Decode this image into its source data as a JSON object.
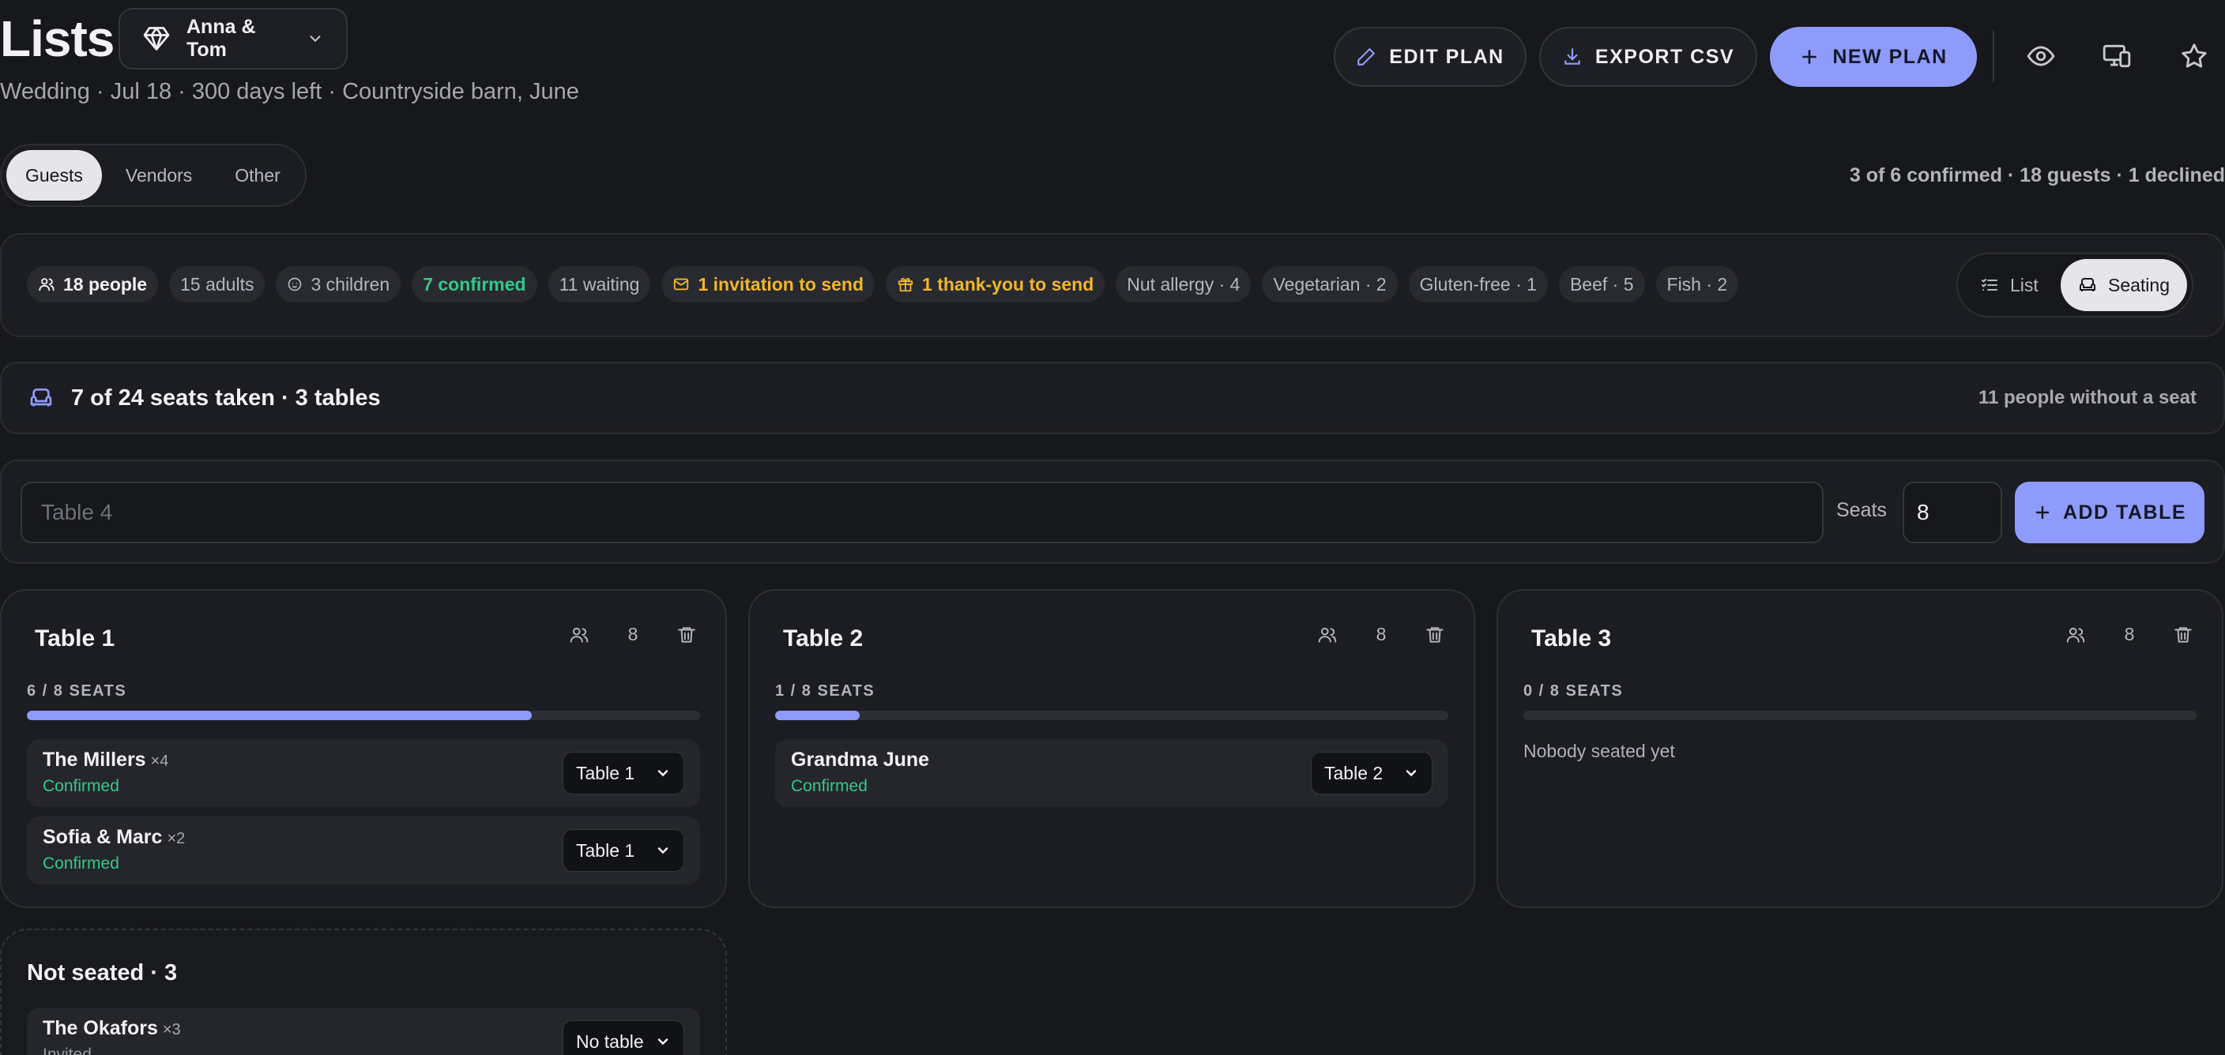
{
  "header": {
    "title": "Lists",
    "plan_name": "Anna & Tom",
    "subtitle": "Wedding · Jul 18 · 300 days left · Countryside barn, June",
    "edit_label": "EDIT PLAN",
    "export_label": "EXPORT CSV",
    "new_label": "NEW PLAN"
  },
  "tabs": {
    "items": [
      "Guests",
      "Vendors",
      "Other"
    ],
    "active": "Guests"
  },
  "summary": "3 of 6 confirmed · 18 guests · 1 declined",
  "chips": {
    "people": "18 people",
    "adults": "15 adults",
    "children": "3 children",
    "confirmed": "7 confirmed",
    "waiting": "11 waiting",
    "invitation": "1 invitation to send",
    "thankyou": "1 thank-you to send",
    "nut": "Nut allergy · 4",
    "veg": "Vegetarian · 2",
    "gluten": "Gluten-free · 1",
    "beef": "Beef · 5",
    "fish": "Fish · 2"
  },
  "view_toggle": {
    "list": "List",
    "seating": "Seating",
    "active": "Seating"
  },
  "seats_bar": {
    "text": "7 of 24 seats taken · 3 tables",
    "right": "11 people without a seat"
  },
  "add_table": {
    "placeholder": "Table 4",
    "seats_label": "Seats",
    "seats_value": "8",
    "button": "ADD TABLE"
  },
  "tables": [
    {
      "name": "Table 1",
      "capacity": "8",
      "seat_label": "6 / 8 SEATS",
      "fill": 0.75,
      "guests": [
        {
          "name": "The Millers",
          "count": "×4",
          "status": "Confirmed",
          "table": "Table 1"
        },
        {
          "name": "Sofia & Marc",
          "count": "×2",
          "status": "Confirmed",
          "table": "Table 1"
        }
      ]
    },
    {
      "name": "Table 2",
      "capacity": "8",
      "seat_label": "1 / 8 SEATS",
      "fill": 0.125,
      "guests": [
        {
          "name": "Grandma June",
          "count": "",
          "status": "Confirmed",
          "table": "Table 2"
        }
      ]
    },
    {
      "name": "Table 3",
      "capacity": "8",
      "seat_label": "0 / 8 SEATS",
      "fill": 0,
      "empty": "Nobody seated yet",
      "guests": []
    }
  ],
  "not_seated": {
    "title": "Not seated · 3",
    "guests": [
      {
        "name": "The Okafors",
        "count": "×3",
        "status": "Invited",
        "table": "No table"
      }
    ]
  },
  "colors": {
    "accent": "#8e9bfa",
    "confirmed": "#34c98b",
    "warning": "#f0b72b",
    "background": "#17181c"
  }
}
